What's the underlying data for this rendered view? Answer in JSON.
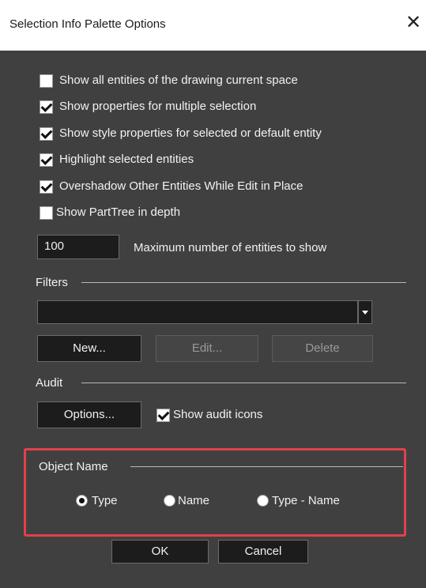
{
  "window": {
    "title": "Selection Info Palette Options",
    "close_glyph": "✕"
  },
  "options": [
    {
      "label": "Show all entities of the drawing current space",
      "checked": false
    },
    {
      "label": "Show properties for multiple selection",
      "checked": true
    },
    {
      "label": "Show style properties for selected or default entity",
      "checked": true
    },
    {
      "label": "Highlight selected entities",
      "checked": true
    },
    {
      "label": "Overshadow Other Entities While Edit in Place",
      "checked": true
    },
    {
      "label": "Show PartTree in depth",
      "checked": false
    }
  ],
  "max_entities": {
    "value": "100",
    "label": "Maximum number of entities to show"
  },
  "filters": {
    "title": "Filters",
    "selected": "",
    "buttons": {
      "new": "New...",
      "edit": "Edit...",
      "delete": "Delete"
    }
  },
  "audit": {
    "title": "Audit",
    "options_button": "Options...",
    "show_icons_label": "Show audit icons",
    "show_icons_checked": true
  },
  "object_name": {
    "title": "Object Name",
    "options": [
      {
        "label": "Type",
        "selected": true
      },
      {
        "label": "Name",
        "selected": false
      },
      {
        "label": "Type - Name",
        "selected": false
      }
    ]
  },
  "footer": {
    "ok": "OK",
    "cancel": "Cancel"
  },
  "colors": {
    "dialog_bg": "#404040",
    "highlight_border": "#e2414b"
  }
}
